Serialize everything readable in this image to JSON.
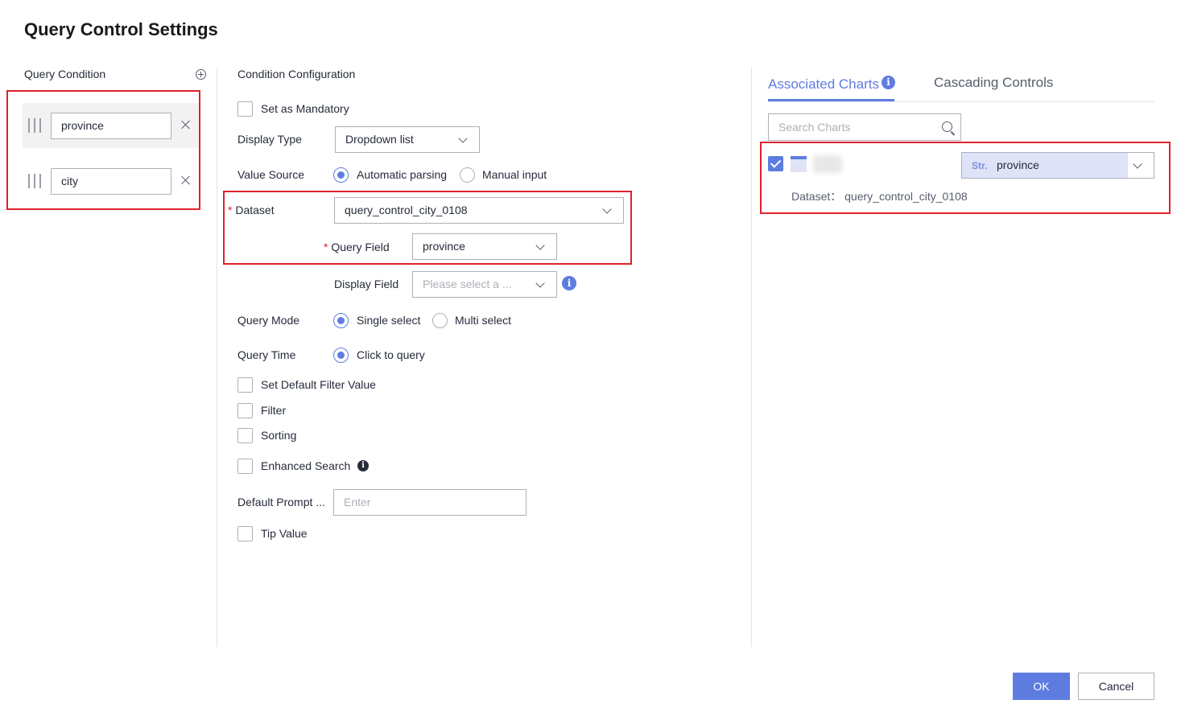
{
  "dialog": {
    "title": "Query Control Settings"
  },
  "left": {
    "title": "Query Condition",
    "conditions": [
      {
        "value": "province"
      },
      {
        "value": "city"
      }
    ]
  },
  "middle": {
    "title": "Condition Configuration",
    "set_mandatory": "Set as Mandatory",
    "display_type_label": "Display Type",
    "display_type_value": "Dropdown list",
    "value_source_label": "Value Source",
    "value_source_options": [
      "Automatic parsing",
      "Manual input"
    ],
    "required_mark": "*",
    "dataset_label": "Dataset",
    "dataset_value": "query_control_city_0108",
    "query_field_label": "Query Field",
    "query_field_value": "province",
    "display_field_label": "Display Field",
    "display_field_placeholder": "Please select a ...",
    "query_mode_label": "Query Mode",
    "query_mode_options": [
      "Single select",
      "Multi select"
    ],
    "query_time_label": "Query Time",
    "query_time_option": "Click to query",
    "default_filter": "Set Default Filter Value",
    "filter": "Filter",
    "sorting": "Sorting",
    "enhanced_search": "Enhanced Search",
    "default_prompt_label": "Default Prompt ...",
    "default_prompt_placeholder": "Enter",
    "tip_value": "Tip Value",
    "info_glyph": "i"
  },
  "right": {
    "tabs": [
      "Associated Charts",
      "Cascading Controls"
    ],
    "search_placeholder": "Search Charts",
    "chart": {
      "field_type": "Str.",
      "field_value": "province",
      "dataset_text": "Dataset： query_control_city_0108"
    }
  },
  "footer": {
    "ok": "OK",
    "cancel": "Cancel"
  },
  "colors": {
    "accent": "#5e7ce0",
    "highlight_border": "#e0212d"
  }
}
